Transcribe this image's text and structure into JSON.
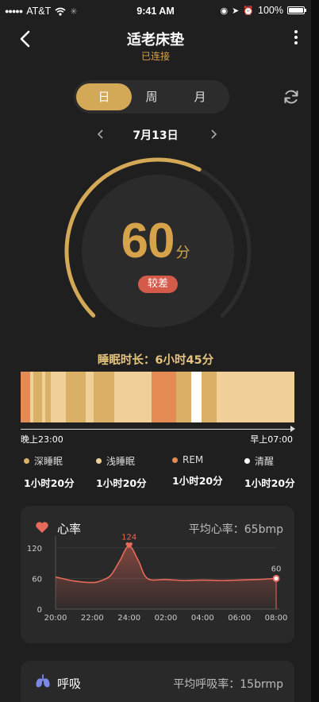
{
  "status_bar": {
    "carrier": "AT&T",
    "time": "9:41 AM",
    "battery": "100%"
  },
  "header": {
    "title": "适老床垫",
    "subtitle": "已连接"
  },
  "period_tabs": [
    {
      "label": "日",
      "active": true
    },
    {
      "label": "周",
      "active": false
    },
    {
      "label": "月",
      "active": false
    }
  ],
  "date_nav": {
    "date": "7月13日"
  },
  "score": {
    "value": "60",
    "unit": "分",
    "level": "较差",
    "progress_percent": 60
  },
  "sleep": {
    "duration_label": "睡眠时长：6小时45分",
    "start_label": "晚上23:00",
    "end_label": "早上07:00",
    "stage_colors": {
      "deep": "#d9b065",
      "light": "#f0d098",
      "rem": "#e38a55",
      "awake": "#ffffff"
    },
    "segments": [
      {
        "stage": "rem",
        "fraction": 0.035
      },
      {
        "stage": "light",
        "fraction": 0.012
      },
      {
        "stage": "deep",
        "fraction": 0.03
      },
      {
        "stage": "light",
        "fraction": 0.012
      },
      {
        "stage": "deep",
        "fraction": 0.02
      },
      {
        "stage": "light",
        "fraction": 0.055
      },
      {
        "stage": "deep",
        "fraction": 0.075
      },
      {
        "stage": "light",
        "fraction": 0.028
      },
      {
        "stage": "deep",
        "fraction": 0.075
      },
      {
        "stage": "light",
        "fraction": 0.135
      },
      {
        "stage": "rem",
        "fraction": 0.09
      },
      {
        "stage": "deep",
        "fraction": 0.055
      },
      {
        "stage": "awake",
        "fraction": 0.04
      },
      {
        "stage": "deep",
        "fraction": 0.055
      },
      {
        "stage": "light",
        "fraction": 0.283
      }
    ],
    "legend": [
      {
        "name": "深睡眠",
        "value": "1小时20分",
        "color": "#d9b065"
      },
      {
        "name": "浅睡眠",
        "value": "1小时20分",
        "color": "#f0d098"
      },
      {
        "name": "REM",
        "value": "1小时20分",
        "color": "#e38a55"
      },
      {
        "name": "清醒",
        "value": "1小时20分",
        "color": "#ffffff"
      }
    ]
  },
  "heart_rate": {
    "title": "心率",
    "average": "平均心率：65bmp",
    "accent": "#e86a5a"
  },
  "breathing": {
    "title": "呼吸",
    "average": "平均呼吸率：15brmp"
  },
  "chart_data": {
    "type": "area",
    "x": [
      "20:00",
      "21:00",
      "22:00",
      "22:30",
      "23:00",
      "23:30",
      "24:00",
      "00:30",
      "01:00",
      "02:00",
      "03:00",
      "04:00",
      "05:00",
      "06:00",
      "07:00",
      "08:00"
    ],
    "xticks": [
      "20:00",
      "22:00",
      "24:00",
      "02:00",
      "04:00",
      "06:00",
      "08:00"
    ],
    "series": [
      {
        "values": [
          63,
          55,
          52,
          56,
          66,
          95,
          124,
          95,
          60,
          58,
          56,
          57,
          56,
          57,
          58,
          60
        ]
      }
    ],
    "annotations": [
      {
        "x": "24:00",
        "value": 124,
        "label": "124"
      },
      {
        "x": "08:00",
        "value": 60,
        "label": "60"
      }
    ],
    "yticks": [
      0,
      60,
      120
    ],
    "ylim": [
      0,
      140
    ]
  }
}
